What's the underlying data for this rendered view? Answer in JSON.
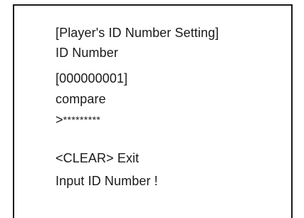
{
  "screen": {
    "title": "[Player's ID Number Setting]",
    "id_label": "ID Number",
    "id_value": "[000000001]",
    "compare_label": "compare",
    "entry_prompt": ">",
    "entry_masked": "*********",
    "clear_hint": "<CLEAR> Exit",
    "instruction": "Input ID Number !"
  }
}
